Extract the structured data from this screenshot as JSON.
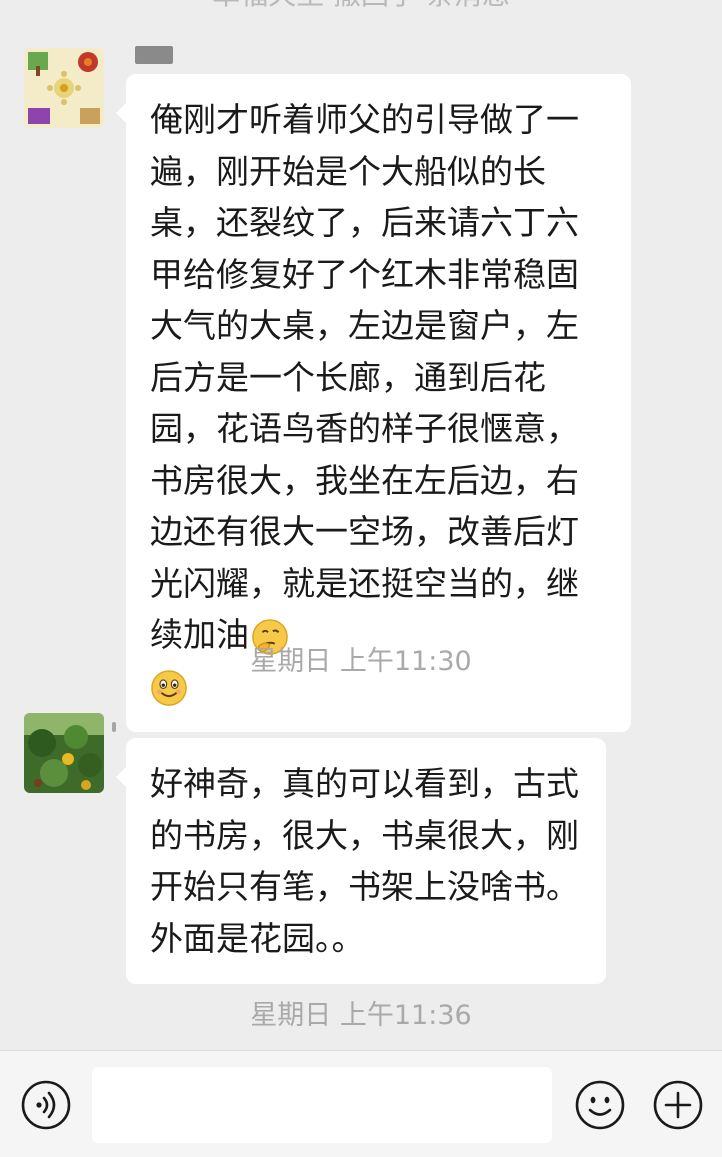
{
  "header_note": "单福天生 撤回了 条消息",
  "messages": [
    {
      "text": "俺刚才听着师父的引导做了一遍，刚开始是个大船似的长桌，还裂纹了，后来请六丁六甲给修复好了个红木非常稳固大气的大桌，左边是窗户，左后方是一个长廊，通到后花园，花语鸟香的样子很惬意，书房很大，我坐在左后边，右边还有很大一空场，改善后灯光闪耀，就是还挺空当的，继续加油",
      "emojis": [
        "thinking-face-icon",
        "smiling-face-icon"
      ]
    },
    {
      "time": "星期日 上午11:30"
    },
    {
      "text": "好神奇，真的可以看到，古式的书房，很大，书桌很大，刚开始只有笔，书架上没啥书。外面是花园。。"
    },
    {
      "time": "星期日 上午11:36"
    }
  ],
  "input_bar": {
    "placeholder": ""
  },
  "colors": {
    "background": "#ededed",
    "bubble": "#ffffff",
    "timestamp": "#a9a9a9"
  }
}
